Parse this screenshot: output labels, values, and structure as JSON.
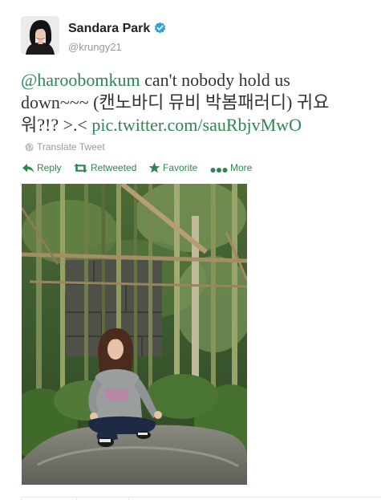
{
  "user": {
    "display_name": "Sandara Park",
    "screen_name": "@krungy21",
    "verified_icon": "verified-badge-icon",
    "avatar_icon": "avatar"
  },
  "tweet": {
    "mention": "@haroobomkum",
    "text_middle": " can't nobody hold us down~~~ (캔노바디 뮤비 박봄패러디) 귀요워?!? >.< ",
    "link": "pic.twitter.com/sauRbjvMwO",
    "link_color": "#2d8750"
  },
  "translate": {
    "label": "Translate Tweet",
    "icon": "globe-icon"
  },
  "actions": {
    "reply": "Reply",
    "retweeted": "Retweeted",
    "favorite": "Favorite",
    "more": "More",
    "accent_color": "#2d8750"
  },
  "photo": {
    "icon": "tweet-photo"
  }
}
